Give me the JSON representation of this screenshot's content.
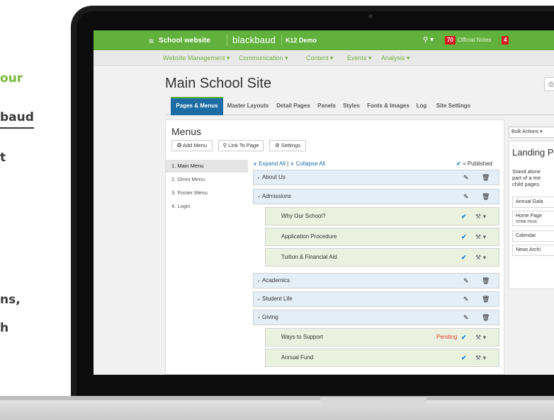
{
  "left_text": [
    "our",
    "baud",
    "t",
    "ns,",
    "h"
  ],
  "topbar": {
    "menu_icon": "hamburger-icon",
    "site_label": "School website",
    "logo": "blackbaud",
    "demo_label": "K12 Demo",
    "search_icon": "search-icon",
    "notes_count": "70",
    "notes_label": "Official Notes",
    "alert_count": "4",
    "accent": "#62b13d"
  },
  "menubar": {
    "items": [
      "Website Management ▾",
      "Communication ▾",
      "Content ▾",
      "Events ▾",
      "Analysis ▾"
    ]
  },
  "page": {
    "title": "Main School Site",
    "title_button_icon": "print-icon",
    "tabs": [
      "Pages & Menus",
      "Master Layouts",
      "Detail Pages",
      "Panels",
      "Styles",
      "Fonts & Images",
      "Log",
      "Site Settings"
    ],
    "active_tab": "Pages & Menus"
  },
  "menus_panel": {
    "heading": "Menus",
    "add_button": "✪ Add Menu",
    "link_button": "⚲ Link To Page",
    "settings_button": "⚙ Settings",
    "menu_list": [
      "1. Main Menu",
      "2. Omni Menu",
      "3. Footer Menu",
      "4. Login"
    ],
    "expand_all": "∨ Expand All",
    "collapse_all": "∧ Collapse All",
    "divider": "|",
    "published_check": "✔",
    "published_legend": "= Published",
    "rows": [
      {
        "label": "About Us",
        "tri": "▸",
        "edit": "✎",
        "trash": "🗑"
      },
      {
        "label": "Admissions",
        "tri": "▾",
        "edit": "✎",
        "trash": "🗑"
      },
      {
        "label": "Why Our School?",
        "check": "✔",
        "wrench": "⚒ ▾"
      },
      {
        "label": "Application Procedure",
        "check": "✔",
        "wrench": "⚒ ▾"
      },
      {
        "label": "Tuition & Financial Aid",
        "check": "✔",
        "wrench": "⚒ ▾"
      },
      {
        "label": "Academics",
        "tri": "▸",
        "edit": "✎",
        "trash": "🗑"
      },
      {
        "label": "Student Life",
        "tri": "▸",
        "edit": "✎",
        "trash": "🗑"
      },
      {
        "label": "Giving",
        "tri": "▾",
        "edit": "✎",
        "trash": "🗑"
      },
      {
        "label": "Ways to Support",
        "pending": "Pending",
        "check": "✔",
        "wrench": "⚒ ▾"
      },
      {
        "label": "Annual Fund",
        "check": "✔",
        "wrench": "⚒ ▾"
      }
    ]
  },
  "side_panel": {
    "bulk_actions": "Bulk Actions ▾",
    "heading": "Landing P",
    "description": [
      "Stand alone",
      "part of a me",
      "child pages."
    ],
    "items": [
      {
        "label": "Annual Gala"
      },
      {
        "label": "Home Page",
        "sub": "HOME PAGE"
      },
      {
        "label": "Calendar"
      },
      {
        "label": "News Archi"
      }
    ]
  }
}
